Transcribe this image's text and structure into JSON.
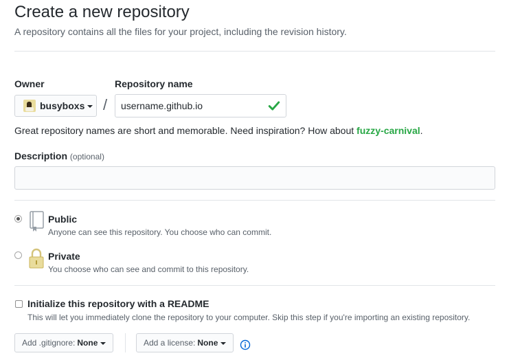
{
  "page": {
    "title": "Create a new repository",
    "subtitle": "A repository contains all the files for your project, including the revision history."
  },
  "owner": {
    "label": "Owner",
    "value": "busyboxs"
  },
  "repository": {
    "label": "Repository name",
    "value": "username.github.io",
    "separator": "/",
    "hint_prefix": "Great repository names are short and memorable. Need inspiration? How about ",
    "suggestion": "fuzzy-carnival",
    "hint_suffix": "."
  },
  "description": {
    "label": "Description",
    "optional": "(optional)",
    "value": ""
  },
  "visibility": {
    "selected": "public",
    "options": [
      {
        "title": "Public",
        "desc": "Anyone can see this repository. You choose who can commit."
      },
      {
        "title": "Private",
        "desc": "You choose who can see and commit to this repository."
      }
    ]
  },
  "init": {
    "label": "Initialize this repository with a README",
    "desc": "This will let you immediately clone the repository to your computer. Skip this step if you're importing an existing repository.",
    "checked": false
  },
  "gitignore": {
    "label": "Add .gitignore:",
    "value": "None"
  },
  "license": {
    "label": "Add a license:",
    "value": "None"
  },
  "colors": {
    "success": "#28a745",
    "border": "#d1d5da",
    "info": "#0366d6",
    "lock": "#dbab09"
  },
  "icons": {
    "valid": "check-icon",
    "public": "repo-icon",
    "private": "lock-icon",
    "help": "info-icon"
  }
}
